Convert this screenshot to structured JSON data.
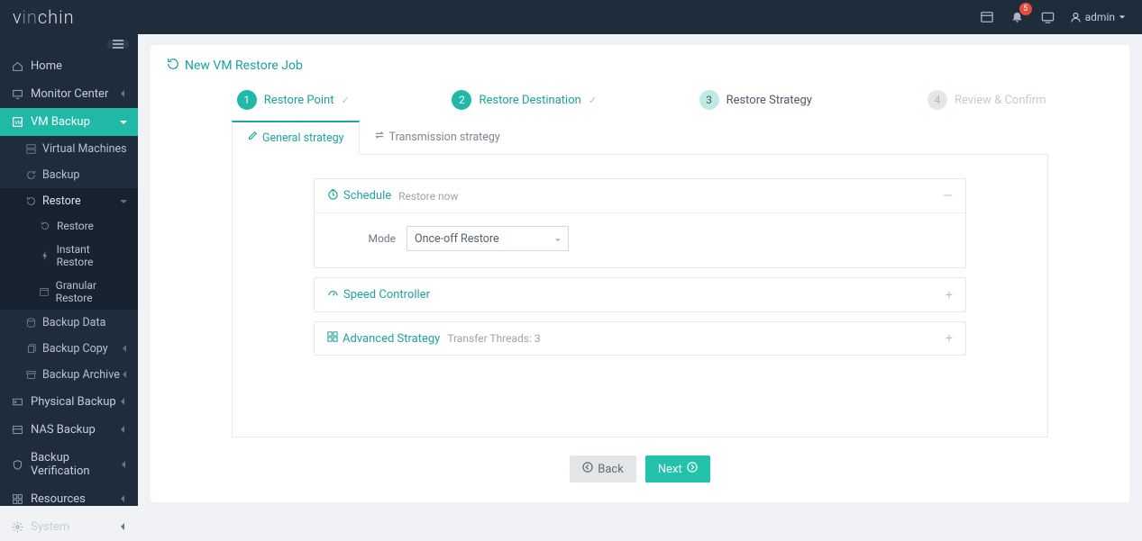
{
  "brand": {
    "v": "v",
    "in": "in",
    "chin": "chin"
  },
  "topbar": {
    "notif_count": "5",
    "username": "admin"
  },
  "sidebar": {
    "home": "Home",
    "monitor": "Monitor Center",
    "vmbackup": "VM Backup",
    "vm_items": {
      "virtual_machines": "Virtual Machines",
      "backup": "Backup",
      "restore": "Restore",
      "restore_sub": {
        "restore": "Restore",
        "instant": "Instant Restore",
        "granular": "Granular Restore"
      },
      "backup_data": "Backup Data",
      "backup_copy": "Backup Copy",
      "backup_archive": "Backup Archive"
    },
    "physical": "Physical Backup",
    "nas": "NAS Backup",
    "verify": "Backup Verification",
    "resources": "Resources",
    "system": "System"
  },
  "page": {
    "title": "New VM Restore Job"
  },
  "steps": [
    {
      "num": "1",
      "label": "Restore Point"
    },
    {
      "num": "2",
      "label": "Restore Destination"
    },
    {
      "num": "3",
      "label": "Restore Strategy"
    },
    {
      "num": "4",
      "label": "Review & Confirm"
    }
  ],
  "tabs": {
    "general": "General strategy",
    "transmission": "Transmission strategy"
  },
  "panels": {
    "schedule": {
      "title": "Schedule",
      "sub": "Restore now",
      "mode_label": "Mode",
      "mode_value": "Once-off Restore"
    },
    "speed": {
      "title": "Speed Controller"
    },
    "advanced": {
      "title": "Advanced Strategy",
      "sub": "Transfer Threads: 3"
    }
  },
  "buttons": {
    "back": "Back",
    "next": "Next"
  }
}
